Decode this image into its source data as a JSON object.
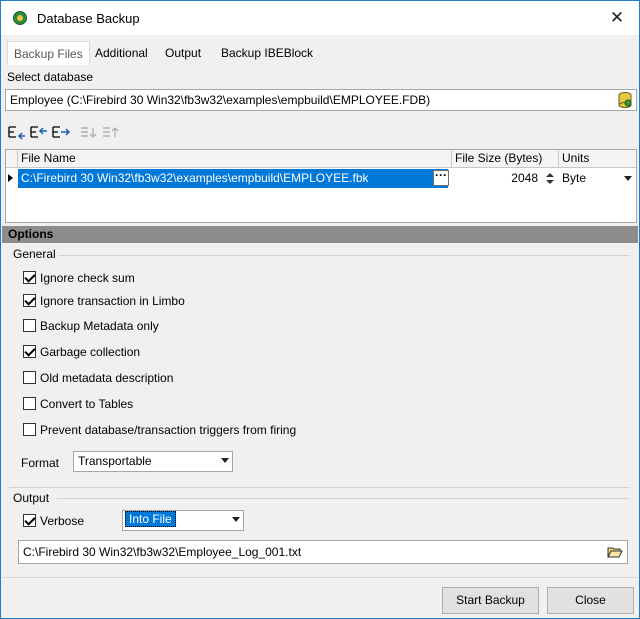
{
  "window": {
    "title": "Database Backup",
    "close_glyph": "✕"
  },
  "tabs": [
    {
      "label": "Backup Files",
      "active": true
    },
    {
      "label": "Additional",
      "active": false
    },
    {
      "label": "Output",
      "active": false
    },
    {
      "label": "Backup IBEBlock",
      "active": false
    }
  ],
  "select_database": {
    "label": "Select database",
    "value": "Employee (C:\\Firebird 30 Win32\\fb3w32\\examples\\empbuild\\EMPLOYEE.FDB)",
    "icon": "database-icon"
  },
  "toolbar": {
    "buttons": [
      "add-file-icon",
      "insert-file-icon",
      "append-file-icon",
      "move-down-icon",
      "move-up-icon"
    ]
  },
  "files_grid": {
    "columns": [
      "File Name",
      "File Size (Bytes)",
      "Units"
    ],
    "rows": [
      {
        "file_name": "C:\\Firebird 30 Win32\\fb3w32\\examples\\empbuild\\EMPLOYEE.fbk",
        "size": "2048",
        "units": "Byte"
      }
    ],
    "ellipsis": "···"
  },
  "options": {
    "title": "Options",
    "general_label": "General",
    "checkboxes": [
      {
        "label": "Ignore check sum",
        "checked": true
      },
      {
        "label": "Ignore transaction in Limbo",
        "checked": true
      },
      {
        "label": "Backup Metadata only",
        "checked": false
      },
      {
        "label": "Garbage collection",
        "checked": true
      },
      {
        "label": "Old metadata description",
        "checked": false
      },
      {
        "label": "Convert to Tables",
        "checked": false
      },
      {
        "label": "Prevent database/transaction triggers from firing",
        "checked": false
      }
    ],
    "format_label": "Format",
    "format_value": "Transportable"
  },
  "output": {
    "label": "Output",
    "verbose_label": "Verbose",
    "verbose_checked": true,
    "mode_value": "Into File",
    "file_path": "C:\\Firebird 30 Win32\\fb3w32\\Employee_Log_001.txt"
  },
  "footer": {
    "start_label": "Start Backup",
    "close_label": "Close"
  },
  "colors": {
    "selection": "#0078d7",
    "options_bar": "#8c8c8c",
    "window_border": "#1e7fc4"
  }
}
